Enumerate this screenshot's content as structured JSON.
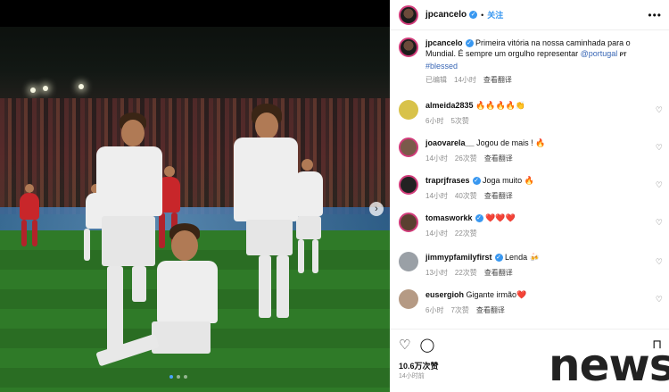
{
  "post": {
    "username": "jpcancelo",
    "follow_label": "关注",
    "more_icon": "more-icon",
    "caption_user": "jpcancelo",
    "caption_text": "Primeira vitória na nossa caminhada para o Mundial. É sempre um orgulho representar ",
    "caption_mention": "@portugal",
    "caption_flag": "PT",
    "caption_hashtag": "#blessed",
    "edited": "已编辑",
    "time": "14小时",
    "translate": "查看翻译"
  },
  "comments": [
    {
      "user": "almeida2835",
      "text": "🔥🔥🔥🔥👏",
      "time": "6小时",
      "likes": "5次赞",
      "translate": "",
      "avatar_color": "#d8c24a",
      "verified": false
    },
    {
      "user": "joaovarela__",
      "text": "Jogou de mais ! 🔥",
      "time": "14小时",
      "likes": "26次赞",
      "translate": "查看翻译",
      "avatar_color": "#7a5a4a",
      "verified": false
    },
    {
      "user": "traprjfrases",
      "text": "Joga muito 🔥",
      "time": "14小时",
      "likes": "40次赞",
      "translate": "查看翻译",
      "avatar_color": "#222222",
      "verified": true
    },
    {
      "user": "tomasworkk",
      "text": "❤️❤️❤️",
      "time": "14小时",
      "likes": "22次赞",
      "translate": "",
      "avatar_color": "#5a4030",
      "verified": true
    },
    {
      "user": "jimmypfamilyfirst",
      "text": "Lenda 🍻",
      "time": "13小时",
      "likes": "22次赞",
      "translate": "查看翻译",
      "avatar_color": "#9aa0a6",
      "verified": true
    },
    {
      "user": "eusergioh",
      "text": "Gigante irmão❤️",
      "time": "6小时",
      "likes": "7次赞",
      "translate": "查看翻译",
      "avatar_color": "#b59a84",
      "verified": false
    }
  ],
  "actions": {
    "likes": "10.6万次赞",
    "time": "14小时前"
  },
  "watermark": "news",
  "colors": {
    "accent": "#3897f0",
    "story_ring": "#d13b7a"
  }
}
